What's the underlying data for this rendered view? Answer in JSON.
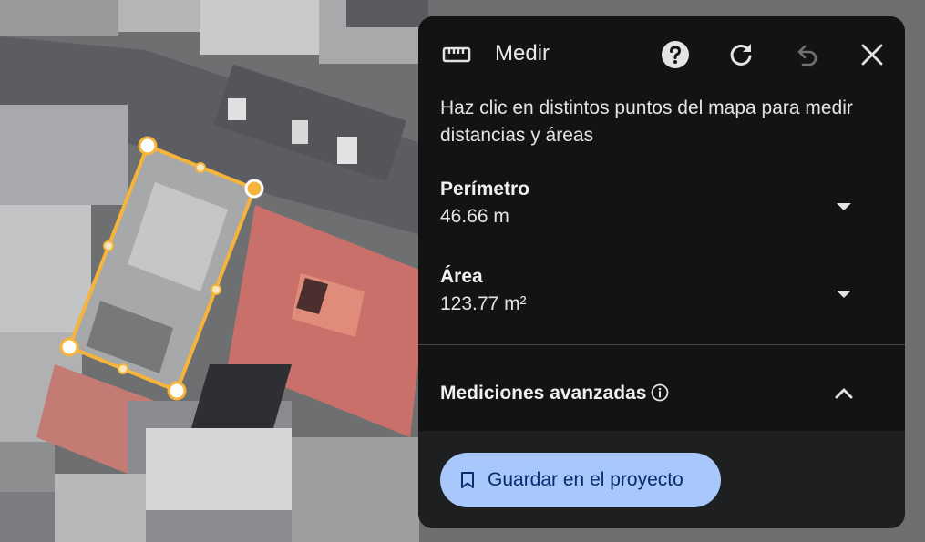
{
  "panel": {
    "title": "Medir",
    "description": "Haz clic en distintos puntos del mapa para medir distancias y áreas",
    "perimeter": {
      "label": "Perímetro",
      "value": "46.66 m"
    },
    "area": {
      "label": "Área",
      "value": "123.77 m²"
    },
    "advanced": {
      "label": "Mediciones avanzadas"
    },
    "save_label": "Guardar en el proyecto"
  },
  "icons": {
    "ruler": "ruler-icon",
    "help": "help-icon",
    "refresh": "refresh-icon",
    "undo": "undo-icon",
    "close": "close-icon",
    "caret_down": "caret-down-icon",
    "info": "info-icon",
    "chevron_up": "chevron-up-icon",
    "bookmark": "bookmark-icon"
  },
  "colors": {
    "panel_bg": "#131314",
    "footer_bg": "#1e1f20",
    "button_bg": "#a8c7fa",
    "button_text": "#062e6f",
    "measure_line": "#f6b53a"
  }
}
